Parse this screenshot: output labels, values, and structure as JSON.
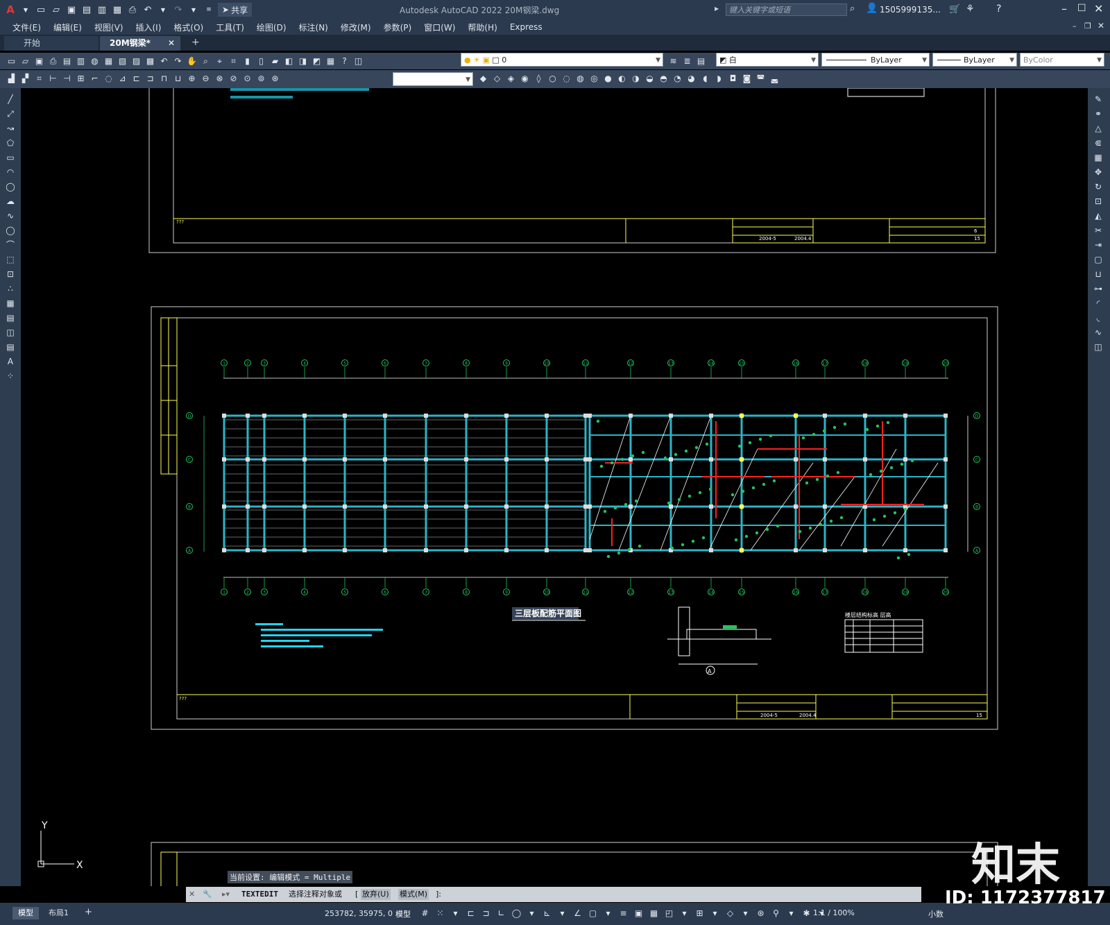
{
  "app": {
    "title": "Autodesk AutoCAD 2022    20M钢梁.dwg",
    "share_label": "共享",
    "search_placeholder": "键入关键字或短语",
    "user": "1505999135...",
    "logo_letter": "A"
  },
  "menu": [
    "文件(E)",
    "编辑(E)",
    "视图(V)",
    "插入(I)",
    "格式(O)",
    "工具(T)",
    "绘图(D)",
    "标注(N)",
    "修改(M)",
    "参数(P)",
    "窗口(W)",
    "帮助(H)",
    "Express"
  ],
  "tabs": [
    {
      "label": "开始",
      "active": false
    },
    {
      "label": "20M钢梁*",
      "active": true
    }
  ],
  "properties": {
    "layer": "0",
    "color": "白",
    "linetype": "ByLayer",
    "lineweight": "ByLayer",
    "plotstyle": "ByColor"
  },
  "drawing": {
    "sheet_title": "三层板配筋平面图",
    "table_title": "楼层结构标高 层高",
    "grid_top_numbers": [
      "1",
      "2",
      "3",
      "4",
      "5",
      "6",
      "7",
      "8",
      "9",
      "10",
      "11",
      "12",
      "13",
      "14",
      "15",
      "16",
      "17",
      "18",
      "19",
      "20"
    ],
    "grid_side_letters": [
      "D",
      "C",
      "B",
      "A"
    ],
    "titleblock": {
      "date1": "2004-5",
      "date2": "2004.4",
      "sheet_no_top": "6",
      "sheet_total": "15",
      "note_marks": "???"
    },
    "ucs_x": "X",
    "ucs_y": "Y",
    "section_label": "A"
  },
  "command": {
    "history": "当前设置: 编辑模式 = Multiple",
    "prompt_cmd": "TEXTEDIT",
    "prompt_text": "选择注释对象或",
    "opt1": "放弃(U)",
    "opt2": "模式(M)",
    "prompt_end": "]:"
  },
  "status": {
    "layout_tabs": [
      "模型",
      "布局1"
    ],
    "coords": "253782, 35975, 0",
    "mode": "模型",
    "scale": "1:1 / 100%",
    "units": "小数"
  },
  "watermark": {
    "logo": "知末",
    "id": "ID: 1172377817"
  }
}
